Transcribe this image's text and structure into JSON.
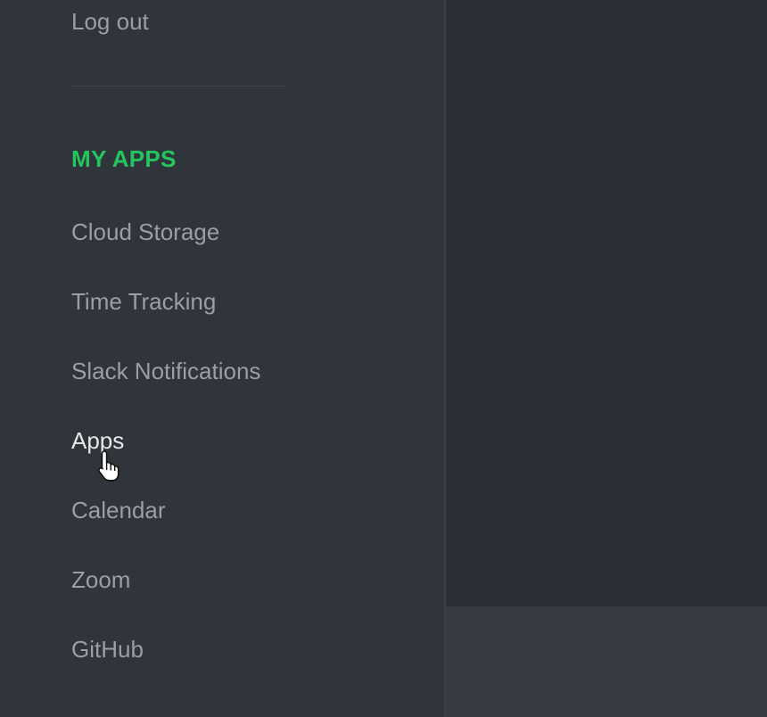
{
  "sidebar": {
    "logout_label": "Log out",
    "section_title": "MY APPS",
    "items": [
      {
        "label": "Cloud Storage"
      },
      {
        "label": "Time Tracking"
      },
      {
        "label": "Slack Notifications"
      },
      {
        "label": "Apps"
      },
      {
        "label": "Calendar"
      },
      {
        "label": "Zoom"
      },
      {
        "label": "GitHub"
      }
    ]
  },
  "colors": {
    "accent": "#22c55e",
    "link": "#9b9ea3",
    "link_hover": "#e6e7e9",
    "sidebar_bg": "#30343b",
    "main_bg": "#2b2e35",
    "footer_bg": "#363c42"
  },
  "cursor": {
    "icon": "hand-pointer-icon"
  }
}
